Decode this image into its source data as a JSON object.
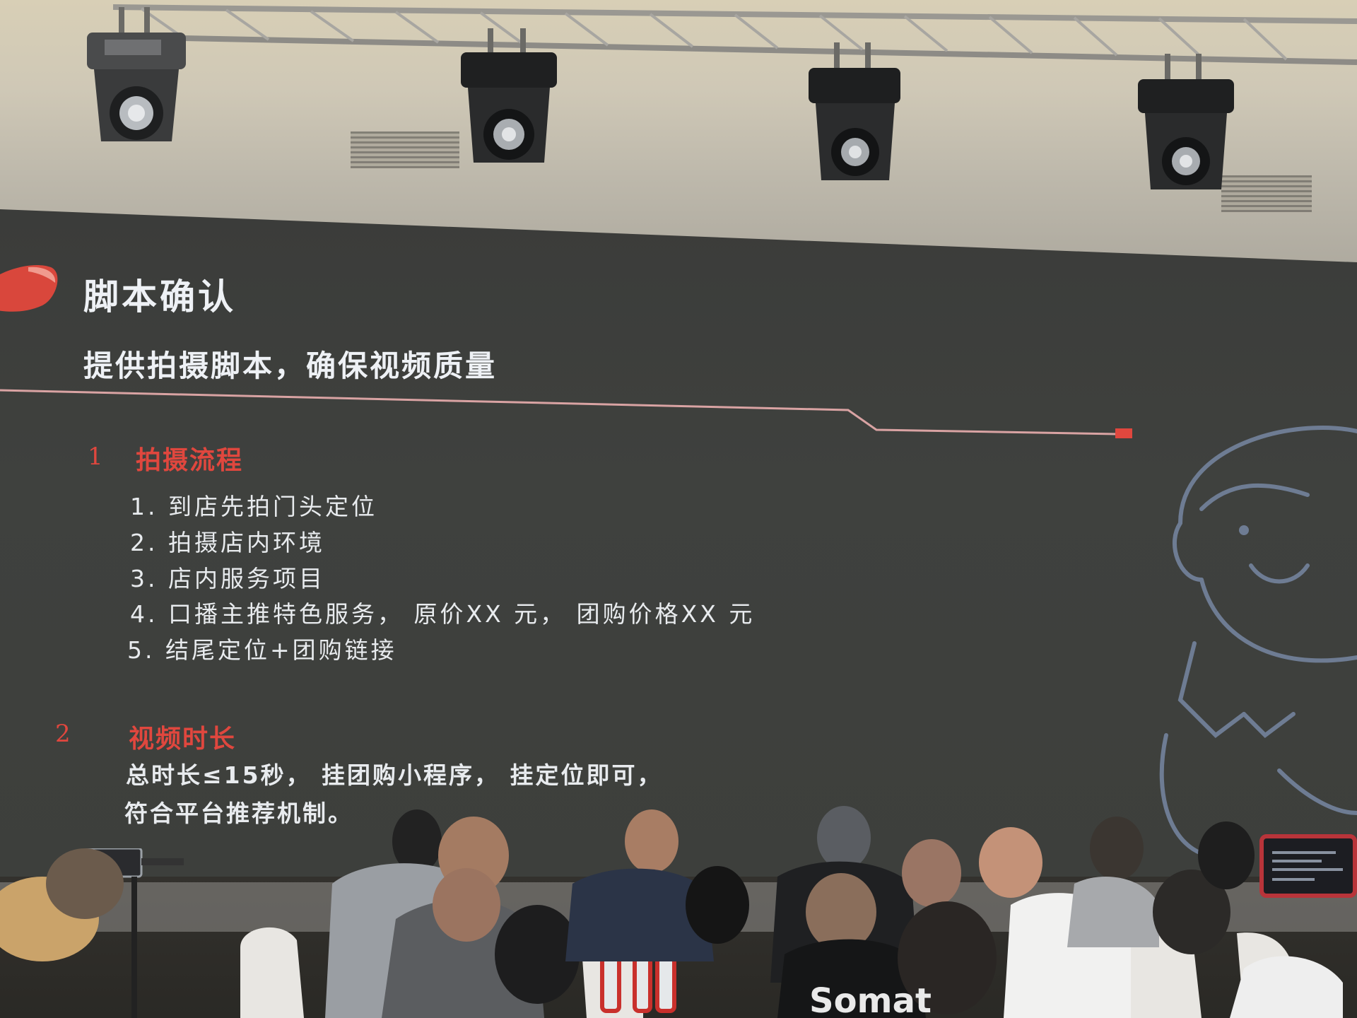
{
  "slide": {
    "title": "脚本确认",
    "subtitle": "提供拍摄脚本，确保视频质量",
    "sections": [
      {
        "number": "1",
        "heading": "拍摄流程",
        "steps": [
          "1. 到店先拍门头定位",
          "2. 拍摄店内环境",
          "3. 店内服务项目",
          "4. 口播主推特色服务， 原价XX 元， 团购价格XX 元",
          "5. 结尾定位+团购链接"
        ]
      },
      {
        "number": "2",
        "heading": "视频时长",
        "lines": [
          "总时长≤15秒， 挂团购小程序， 挂定位即可，",
          "符合平台推荐机制。"
        ]
      }
    ]
  },
  "audience_shirt_text": "Somat",
  "colors": {
    "screen_bg": "#3d3f3c",
    "heading_red": "#e0473e",
    "text_white": "#e8ebee",
    "divider": "#d9a3a3",
    "marker_red": "#e0473e"
  },
  "icons": [
    "stage-light-icon",
    "cartoon-person-icon",
    "red-accent-shape"
  ]
}
